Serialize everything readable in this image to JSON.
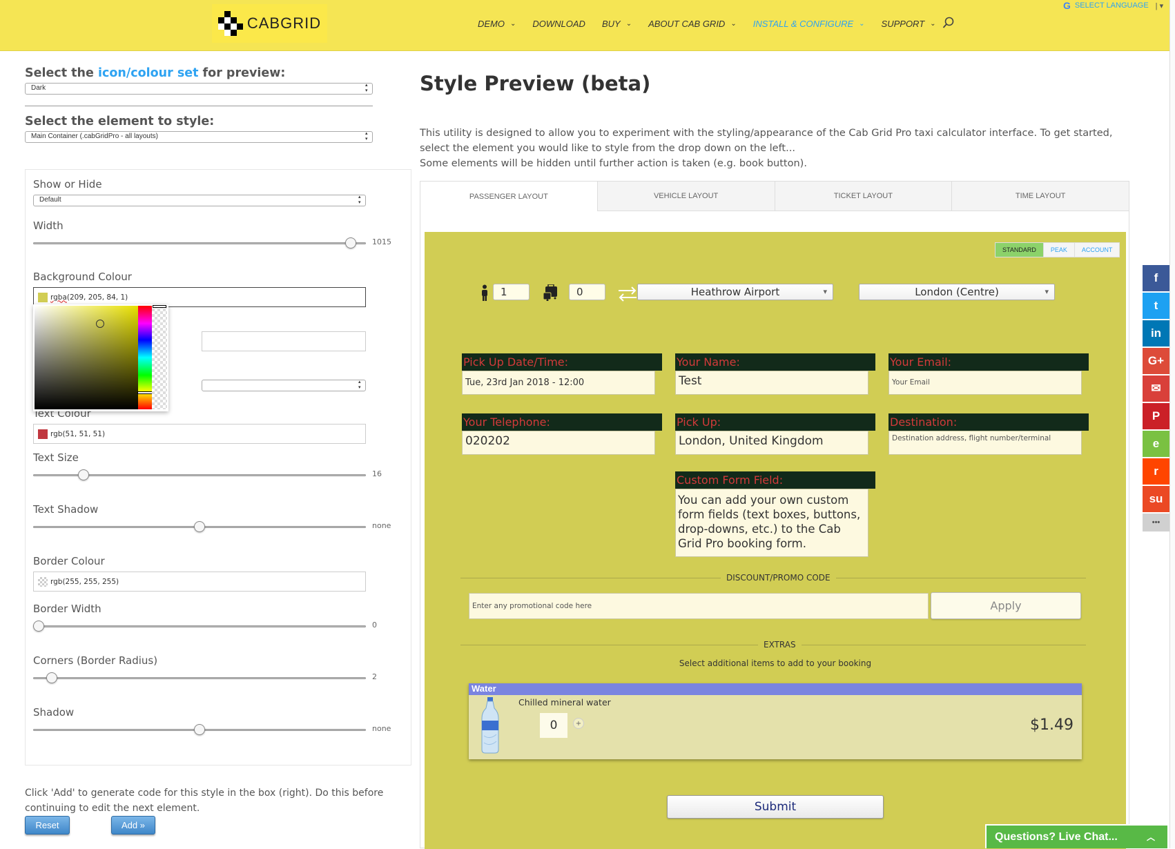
{
  "header": {
    "logo_text": "CABGRID",
    "nav": [
      {
        "label": "DEMO",
        "chevron": true
      },
      {
        "label": "DOWNLOAD",
        "chevron": false
      },
      {
        "label": "BUY",
        "chevron": true
      },
      {
        "label": "ABOUT CAB GRID",
        "chevron": true
      },
      {
        "label": "INSTALL & CONFIGURE",
        "chevron": true,
        "active": true
      },
      {
        "label": "SUPPORT",
        "chevron": true
      }
    ],
    "language_label": "SELECT LANGUAGE"
  },
  "left": {
    "icon_set_label_pre": "Select the ",
    "icon_set_label_link": "icon/colour set",
    "icon_set_label_post": " for preview:",
    "icon_set_value": "Dark",
    "element_label": "Select the element to style:",
    "element_value": "Main Container (.cabGridPro - all layouts)",
    "show_hide": {
      "label": "Show or Hide",
      "value": "Default"
    },
    "width": {
      "label": "Width",
      "value": "1015",
      "level": 0.97
    },
    "background_colour": {
      "label": "Background Colour",
      "value_prefix": "rgba",
      "value": "(209, 205, 84, 1)",
      "swatch": "#d1cd54"
    },
    "text_colour": {
      "label": "Text Colour",
      "value": "rgb(51, 51, 51)",
      "swatch": "#c0373f"
    },
    "text_size": {
      "label": "Text Size",
      "value": "16",
      "level": 0.14
    },
    "text_shadow": {
      "label": "Text Shadow",
      "value": "none",
      "level": 0.5
    },
    "border_colour": {
      "label": "Border Colour",
      "value": "rgb(255, 255, 255)"
    },
    "border_width": {
      "label": "Border Width",
      "value": "0",
      "level": 0.0
    },
    "corners": {
      "label": "Corners (Border Radius)",
      "value": "2",
      "level": 0.04
    },
    "shadow": {
      "label": "Shadow",
      "value": "none",
      "level": 0.5
    },
    "hint": "Click 'Add' to generate code for this style in the box (right). Do this before continuing to edit the next element.",
    "reset_label": "Reset",
    "add_label": "Add »"
  },
  "main": {
    "title": "Style Preview (beta)",
    "intro_line1": "This utility is designed to allow you to experiment with the styling/appearance of the Cab Grid Pro taxi calculator interface. To get started, select the element you would like to style from the drop down on the left...",
    "intro_line2": "Some elements will be hidden until further action is taken (e.g. book button).",
    "tabs": [
      "PASSENGER LAYOUT",
      "VEHICLE LAYOUT",
      "TICKET LAYOUT",
      "TIME LAYOUT"
    ],
    "rate_tabs": [
      "STANDARD",
      "PEAK",
      "ACCOUNT"
    ],
    "passengers": "1",
    "luggage": "0",
    "from": "Heathrow Airport",
    "to": "London (Centre)",
    "fields": [
      {
        "label": "Pick Up Date/Time:",
        "value": "Tue, 23rd Jan 2018 - 12:00"
      },
      {
        "label": "Your Name:",
        "value": "Test"
      },
      {
        "label": "Your Email:",
        "value": "Your Email"
      },
      {
        "label": "Your Telephone:",
        "value": "020202"
      },
      {
        "label": "Pick Up:",
        "value": "London, United Kingdom"
      },
      {
        "label": "Destination:",
        "value": "Destination address, flight number/terminal"
      },
      {
        "label": "Custom Form Field:",
        "value": "You can add your own custom form fields (text boxes, buttons, drop-downs, etc.) to the Cab Grid Pro booking form."
      }
    ],
    "promo_heading": "DISCOUNT/PROMO CODE",
    "promo_placeholder": "Enter any promotional code here",
    "apply_label": "Apply",
    "extras_heading": "EXTRAS",
    "extras_sub": "Select additional items to add to your booking",
    "extra_title": "Water",
    "extra_desc": "Chilled mineral water",
    "extra_qty": "0",
    "extra_plus": "+",
    "extra_price": "$1.49",
    "submit_label": "Submit"
  },
  "social": [
    {
      "icon": "facebook-icon",
      "glyph": "f",
      "color": "#3b5998"
    },
    {
      "icon": "twitter-icon",
      "glyph": "t",
      "color": "#1da1f2"
    },
    {
      "icon": "linkedin-icon",
      "glyph": "in",
      "color": "#0077b5"
    },
    {
      "icon": "google-plus-icon",
      "glyph": "G+",
      "color": "#dd4b39"
    },
    {
      "icon": "email-icon",
      "glyph": "✉",
      "color": "#d9403a"
    },
    {
      "icon": "pinterest-icon",
      "glyph": "P",
      "color": "#cb2027"
    },
    {
      "icon": "evernote-icon",
      "glyph": "e",
      "color": "#7ac142"
    },
    {
      "icon": "reddit-icon",
      "glyph": "r",
      "color": "#ff4500"
    },
    {
      "icon": "stumbleupon-icon",
      "glyph": "su",
      "color": "#eb4924"
    },
    {
      "icon": "more-icon",
      "glyph": "•••",
      "color": "#d0d0d0"
    }
  ],
  "chat_label": "Questions? Live Chat..."
}
